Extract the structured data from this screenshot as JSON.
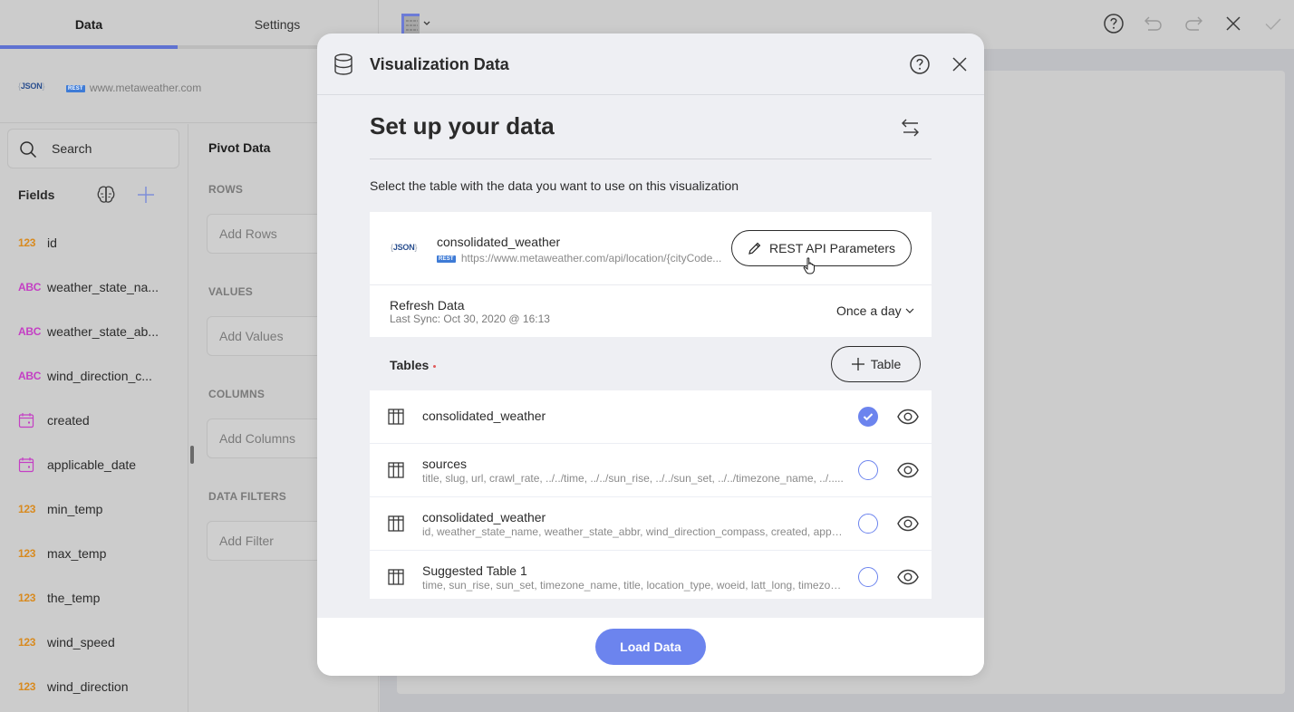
{
  "left_panel": {
    "tabs": [
      {
        "label": "Data",
        "active": true
      },
      {
        "label": "Settings",
        "active": false
      }
    ],
    "source": {
      "logo_text": "JSON",
      "badge": "REST",
      "url": "www.metaweather.com"
    },
    "search": {
      "placeholder": "Search"
    },
    "fields_header": "Fields",
    "fields": [
      {
        "type": "123",
        "kind": "number",
        "name": "id"
      },
      {
        "type": "ABC",
        "kind": "text",
        "name": "weather_state_na..."
      },
      {
        "type": "ABC",
        "kind": "text",
        "name": "weather_state_ab..."
      },
      {
        "type": "ABC",
        "kind": "text",
        "name": "wind_direction_c..."
      },
      {
        "type": "calendar-icon",
        "kind": "date",
        "name": "created"
      },
      {
        "type": "calendar-icon",
        "kind": "date",
        "name": "applicable_date"
      },
      {
        "type": "123",
        "kind": "number",
        "name": "min_temp"
      },
      {
        "type": "123",
        "kind": "number",
        "name": "max_temp"
      },
      {
        "type": "123",
        "kind": "number",
        "name": "the_temp"
      },
      {
        "type": "123",
        "kind": "number",
        "name": "wind_speed"
      },
      {
        "type": "123",
        "kind": "number",
        "name": "wind_direction"
      }
    ],
    "pivot": {
      "title": "Pivot Data",
      "sections": [
        {
          "label": "ROWS",
          "placeholder": "Add Rows"
        },
        {
          "label": "VALUES",
          "placeholder": "Add Values"
        },
        {
          "label": "COLUMNS",
          "placeholder": "Add Columns"
        },
        {
          "label": "DATA FILTERS",
          "placeholder": "Add Filter"
        }
      ]
    }
  },
  "toolbar": {
    "icons": [
      "visualization-type-icon",
      "help-icon",
      "undo-icon",
      "redo-icon",
      "close-icon",
      "check-icon"
    ]
  },
  "modal": {
    "title": "Visualization Data",
    "heading": "Set up your data",
    "description": "Select the table with the data you want to use on this visualization",
    "source": {
      "logo_text": "JSON",
      "name": "consolidated_weather",
      "badge": "REST",
      "url": "https://www.metaweather.com/api/location/{cityCode...",
      "rest_button": "REST API Parameters"
    },
    "refresh": {
      "label": "Refresh Data",
      "last_sync": "Last Sync: Oct 30, 2020 @ 16:13",
      "frequency": "Once a day"
    },
    "tables_label": "Tables",
    "add_table_button": "Table",
    "tables": [
      {
        "name": "consolidated_weather",
        "columns": "",
        "selected": true
      },
      {
        "name": "sources",
        "columns": "title, slug, url, crawl_rate, ../../time, ../../sun_rise, ../../sun_set, ../../timezone_name, ../.....",
        "selected": false
      },
      {
        "name": "consolidated_weather",
        "columns": "id, weather_state_name, weather_state_abbr, wind_direction_compass, created, applic...",
        "selected": false
      },
      {
        "name": "Suggested Table 1",
        "columns": "time, sun_rise, sun_set, timezone_name, title, location_type, woeid, latt_long, timezone,...",
        "selected": false
      }
    ],
    "load_button": "Load Data"
  },
  "colors": {
    "accent": "#6c84ee",
    "tab_underline": "#5f72d1",
    "number_type": "#d88a1f",
    "text_type": "#c43fc4",
    "rest_badge": "#3e7bd6",
    "required": "#e05a5a"
  }
}
